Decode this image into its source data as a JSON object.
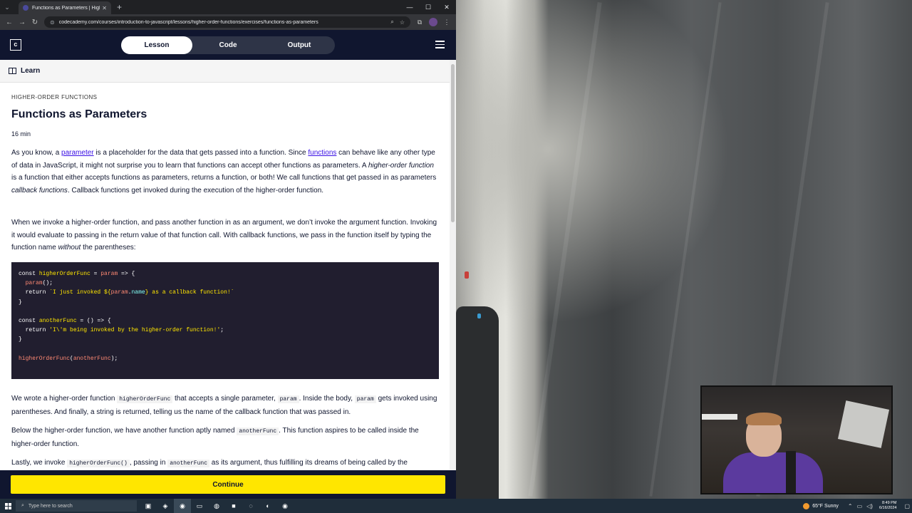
{
  "browser": {
    "tab_title": "Functions as Parameters | Highe",
    "url": "codecademy.com/courses/introduction-to-javascript/lessons/higher-order-functions/exercises/functions-as-parameters"
  },
  "header": {
    "tabs": [
      "Lesson",
      "Code",
      "Output"
    ],
    "active_tab": "Lesson"
  },
  "learnbar": {
    "label": "Learn"
  },
  "lesson": {
    "kicker": "HIGHER-ORDER FUNCTIONS",
    "title": "Functions as Parameters",
    "duration": "16 min",
    "p1": {
      "t1": "As you know, a ",
      "link1": "parameter",
      "t2": " is a placeholder for the data that gets passed into a function. Since ",
      "link2": "functions",
      "t3": " can behave like any other type of data in JavaScript, it might not surprise you to learn that functions can accept other functions as parameters. A ",
      "em1": "higher-order function",
      "t4": " is a function that either accepts functions as parameters, returns a function, or both! We call functions that get passed in as parameters ",
      "em2": "callback functions",
      "t5": ". Callback functions get invoked during the execution of the higher-order function."
    },
    "p2": {
      "t1": "When we invoke a higher-order function, and pass another function in as an argument, we don’t invoke the argument function. Invoking it would evaluate to passing in the return value of that function call. With callback functions, we pass in the function itself by typing the function name ",
      "em": "without",
      "t2": " the parentheses:"
    },
    "p3": {
      "t1": "We wrote a higher-order function ",
      "c1": "higherOrderFunc",
      "t2": " that accepts a single parameter, ",
      "c2": "param",
      "t3": ". Inside the body, ",
      "c3": "param",
      "t4": " gets invoked using parentheses. And finally, a string is returned, telling us the name of the callback function that was passed in."
    },
    "p4": {
      "t1": "Below the higher-order function, we have another function aptly named ",
      "c1": "anotherFunc",
      "t2": ". This function aspires to be called inside the higher-order function."
    },
    "p5": {
      "t1": "Lastly, we invoke ",
      "c1": "higherOrderFunc()",
      "t2": ", passing in ",
      "c2": "anotherFunc",
      "t3": " as its argument, thus fulfilling its dreams of being called by the"
    },
    "code": {
      "l1a": "const ",
      "l1b": "higherOrderFunc",
      "l1c": " = ",
      "l1d": "param",
      "l1e": " => {",
      "l2a": "  ",
      "l2b": "param",
      "l2c": "();",
      "l3a": "  return ",
      "l3b": "`I just invoked ",
      "l3c": "${",
      "l3d": "param",
      "l3e": ".",
      "l3f": "name",
      "l3g": "}",
      "l3h": " as a callback function!`",
      "l4": "}",
      "l6a": "const ",
      "l6b": "anotherFunc",
      "l6c": " = () => {",
      "l7a": "  return ",
      "l7b": "'I\\'m being invoked by the higher-order function!'",
      "l7c": ";",
      "l8": "}",
      "l10a": "higherOrderFunc",
      "l10b": "(",
      "l10c": "anotherFunc",
      "l10d": ");"
    }
  },
  "footer": {
    "continue_label": "Continue"
  },
  "taskbar": {
    "search_placeholder": "Type here to search",
    "weather": "65°F  Sunny",
    "time": "8:49 PM",
    "date": "6/16/2024"
  },
  "colors": {
    "accent": "#ffe600",
    "navy": "#10162f",
    "link": "#3a10e5"
  }
}
